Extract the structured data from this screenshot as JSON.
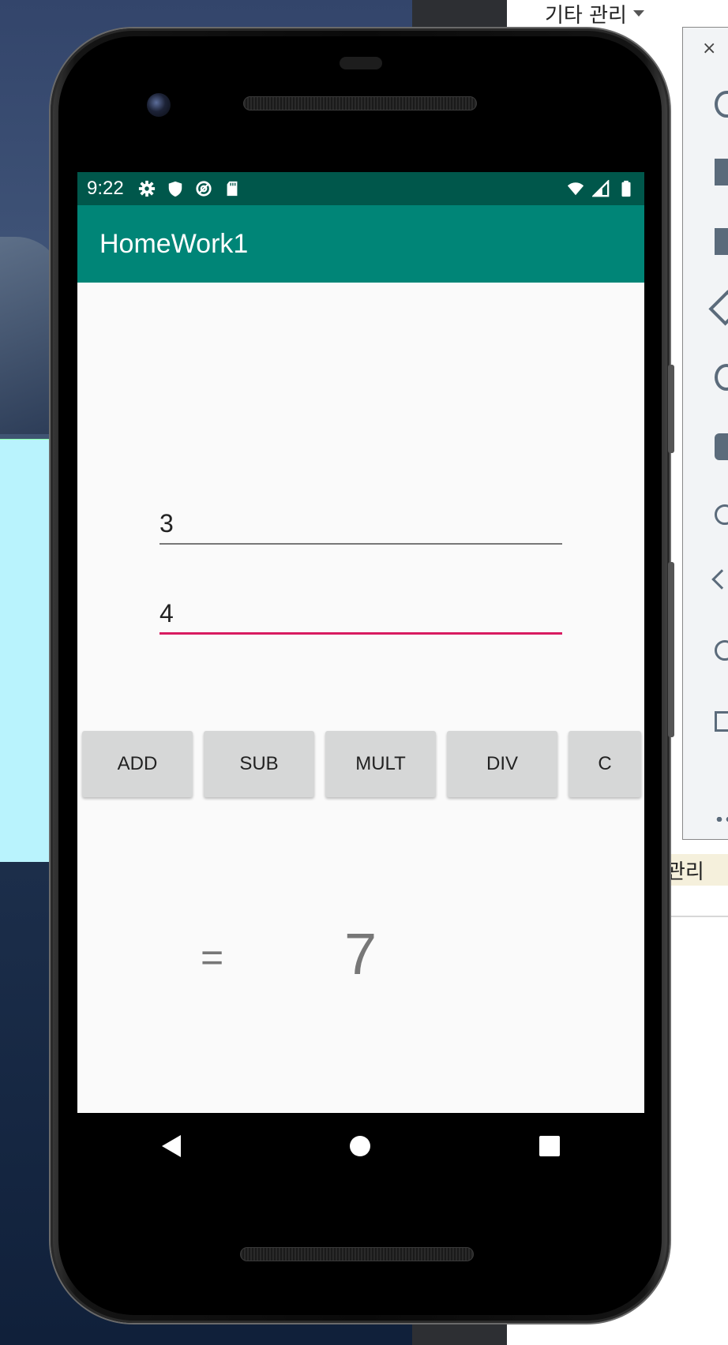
{
  "desktop": {
    "other_menu_label": "기타 관리",
    "manage_label": "관리",
    "side_panel_close": "×"
  },
  "status_bar": {
    "time": "9:22",
    "left_icons": [
      "settings-icon",
      "shield-icon",
      "at-sign-icon",
      "sd-card-icon"
    ],
    "right_icons": [
      "wifi-icon",
      "signal-icon",
      "battery-icon"
    ]
  },
  "app": {
    "title": "HomeWork1",
    "input1_value": "3",
    "input2_value": "4",
    "buttons": {
      "add": "ADD",
      "sub": "SUB",
      "mult": "MULT",
      "div": "DIV",
      "clear": "C"
    },
    "equals": "=",
    "result": "7"
  },
  "colors": {
    "status_bar": "#00574b",
    "app_bar": "#008577",
    "focus_underline": "#d81b60",
    "button_bg": "#d6d7d7"
  },
  "nav_bar": {
    "icons": [
      "back-icon",
      "home-icon",
      "recents-icon"
    ]
  }
}
